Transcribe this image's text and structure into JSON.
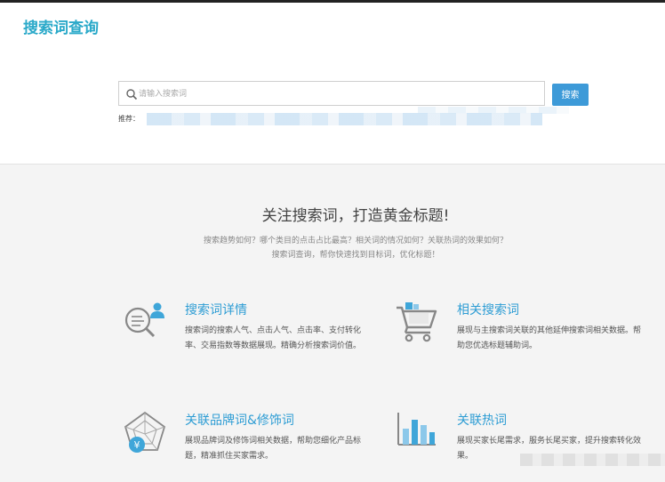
{
  "app": {
    "title": "搜索词查询"
  },
  "search": {
    "placeholder": "请输入搜索词",
    "button_label": "搜索",
    "recommend_label": "推荐："
  },
  "promo": {
    "heading": "关注搜索词，打造黄金标题!",
    "line1": "搜索趋势如何？哪个类目的点击占比最高？相关词的情况如何？关联热词的效果如何？",
    "line2": "搜索词查询，帮你快速找到目标词，优化标题！"
  },
  "features": [
    {
      "title": "搜索词详情",
      "desc": "搜索词的搜索人气、点击人气、点击率、支付转化率、交易指数等数据展现。精确分析搜索词价值。",
      "icon": "magnifier-user-icon"
    },
    {
      "title": "相关搜索词",
      "desc": "展现与主搜索词关联的其他延伸搜索词相关数据。帮助您优选标题辅助词。",
      "icon": "shopping-cart-icon"
    },
    {
      "title": "关联品牌词&修饰词",
      "desc": "展现品牌词及修饰词相关数据，帮助您细化产品标题，精准抓住买家需求。",
      "icon": "radar-yuan-icon"
    },
    {
      "title": "关联热词",
      "desc": "展现买家长尾需求，服务长尾买家，提升搜索转化效果。",
      "icon": "bar-chart-icon"
    }
  ],
  "colors": {
    "brand": "#2aa9c9",
    "accent_blue": "#3d9ad8",
    "feature_title": "#2e9dd4"
  }
}
